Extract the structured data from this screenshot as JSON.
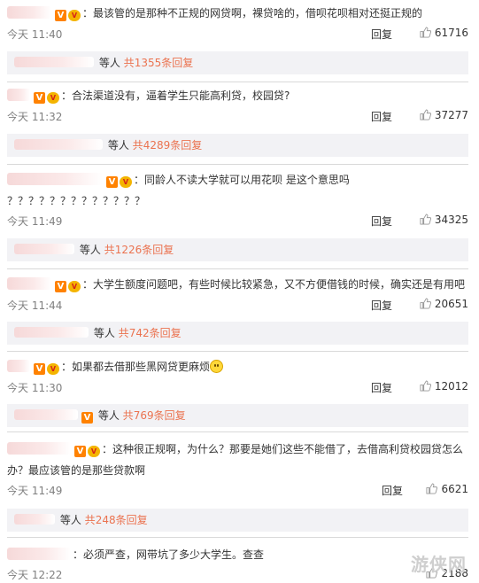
{
  "ui": {
    "reply_label": "回复",
    "reply_prefix": "等人",
    "reply_suffix": "条回复",
    "reply_pre": "共",
    "colon": "："
  },
  "comments": [
    {
      "text": "最该管的是那种不正规的网贷啊，裸贷啥的，借呗花呗相对还挺正规的",
      "time": "今天 11:40",
      "likes": "61716",
      "reply_count": "1355"
    },
    {
      "text": "合法渠道没有，逼着学生只能高利贷，校园贷?",
      "time": "今天 11:32",
      "likes": "37277",
      "reply_count": "4289"
    },
    {
      "text": "同龄人不读大学就可以用花呗 是这个意思吗",
      "text2": "？？？？？？？？？？？？？",
      "time": "今天 11:49",
      "likes": "34325",
      "reply_count": "1226"
    },
    {
      "text": "大学生额度问题吧，有些时候比较紧急，又不方便借钱的时候，确实还是有用吧",
      "time": "今天 11:44",
      "likes": "20651",
      "reply_count": "742"
    },
    {
      "text": "如果都去借那些黑网贷更麻烦",
      "time": "今天 11:30",
      "likes": "12012",
      "reply_count": "769"
    },
    {
      "text": "这种很正规啊，为什么？那要是她们这些不能借了，去借高利贷校园贷怎么",
      "text2": "办？最应该管的是那些贷款啊",
      "time": "今天 11:49",
      "likes": "6621",
      "reply_count": "248"
    },
    {
      "text": "必须严查，网带坑了多少大学生。查查",
      "time": "今天 12:22",
      "likes": "2188"
    }
  ],
  "watermark": "游侠网",
  "icons": {
    "verified": "verified-v-icon",
    "level": "vip-level-icon",
    "like": "thumb-up-icon",
    "emoji": "smile-emoji-icon"
  },
  "colors": {
    "reply_count": "#eb7350",
    "verified": "#ff8200",
    "replybar_bg": "#f2f2f5"
  }
}
